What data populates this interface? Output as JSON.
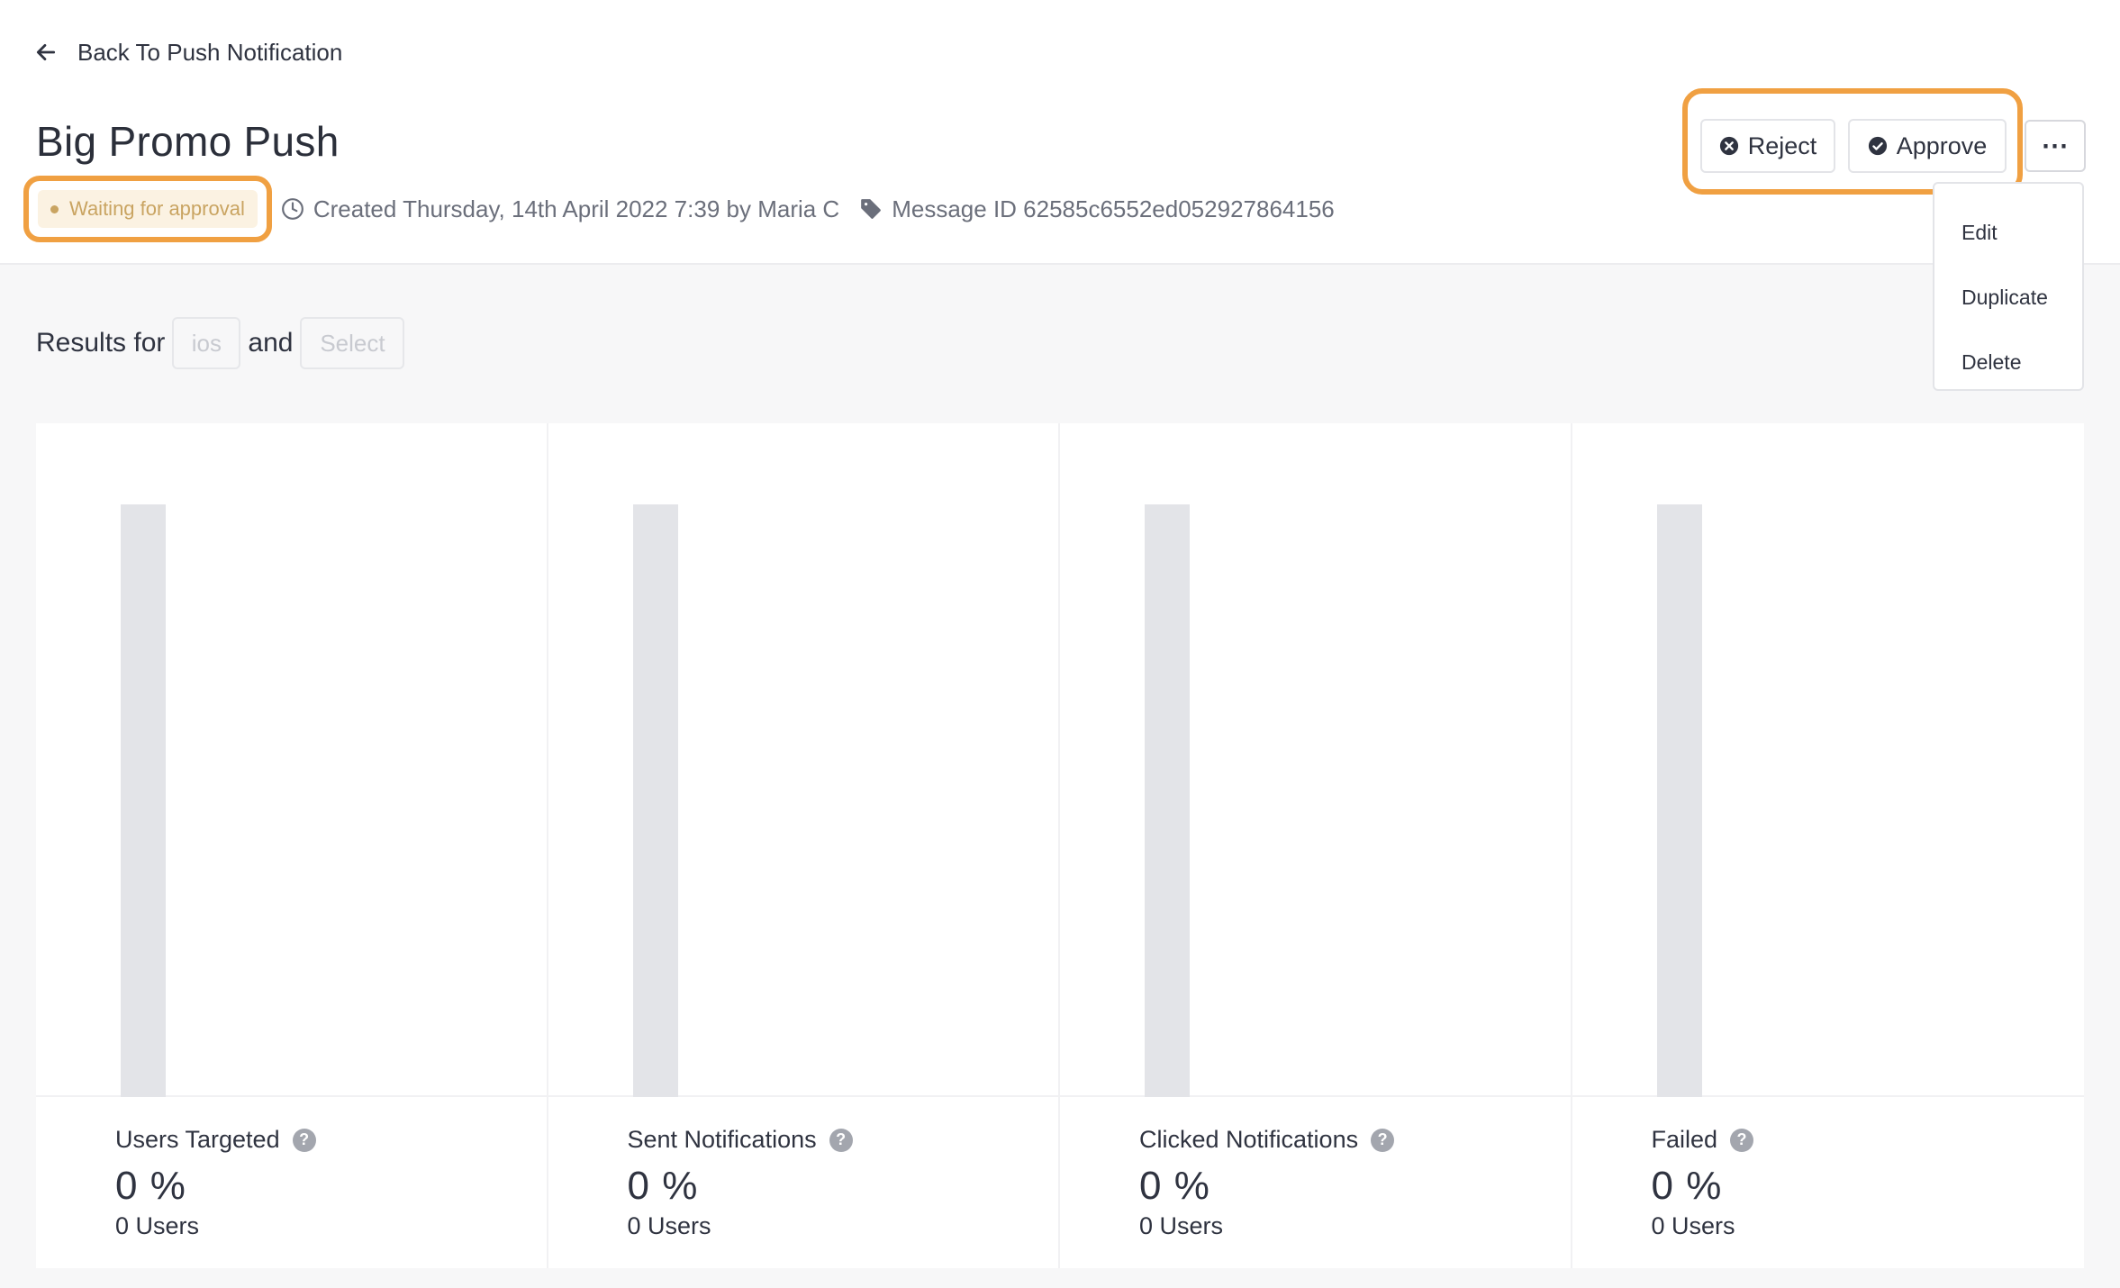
{
  "nav": {
    "back_label": "Back To Push Notification"
  },
  "message": {
    "title": "Big Promo Push",
    "status": "Waiting for approval",
    "created": "Created Thursday, 14th April 2022 7:39 by Maria C",
    "message_id": "Message ID 62585c6552ed052927864156"
  },
  "actions": {
    "reject_label": "Reject",
    "approve_label": "Approve",
    "more_label": "⋯",
    "menu": [
      "Edit",
      "Duplicate",
      "Delete"
    ]
  },
  "filters": {
    "results_for": "Results for",
    "conjunction": "and",
    "platform": "ios",
    "secondary": "Select"
  },
  "stats": [
    {
      "label": "Users Targeted",
      "percent_text": "0 %",
      "users_text": "0 Users",
      "percent": 0
    },
    {
      "label": "Sent Notifications",
      "percent_text": "0 %",
      "users_text": "0 Users",
      "percent": 0
    },
    {
      "label": "Clicked Notifications",
      "percent_text": "0 %",
      "users_text": "0 Users",
      "percent": 0
    },
    {
      "label": "Failed",
      "percent_text": "0 %",
      "users_text": "0 Users",
      "percent": 0
    }
  ],
  "colors": {
    "highlight": "#f0a042",
    "status_bg": "#fbf2e2",
    "status_text": "#c9a461",
    "bar_track": "#e3e4e8"
  }
}
